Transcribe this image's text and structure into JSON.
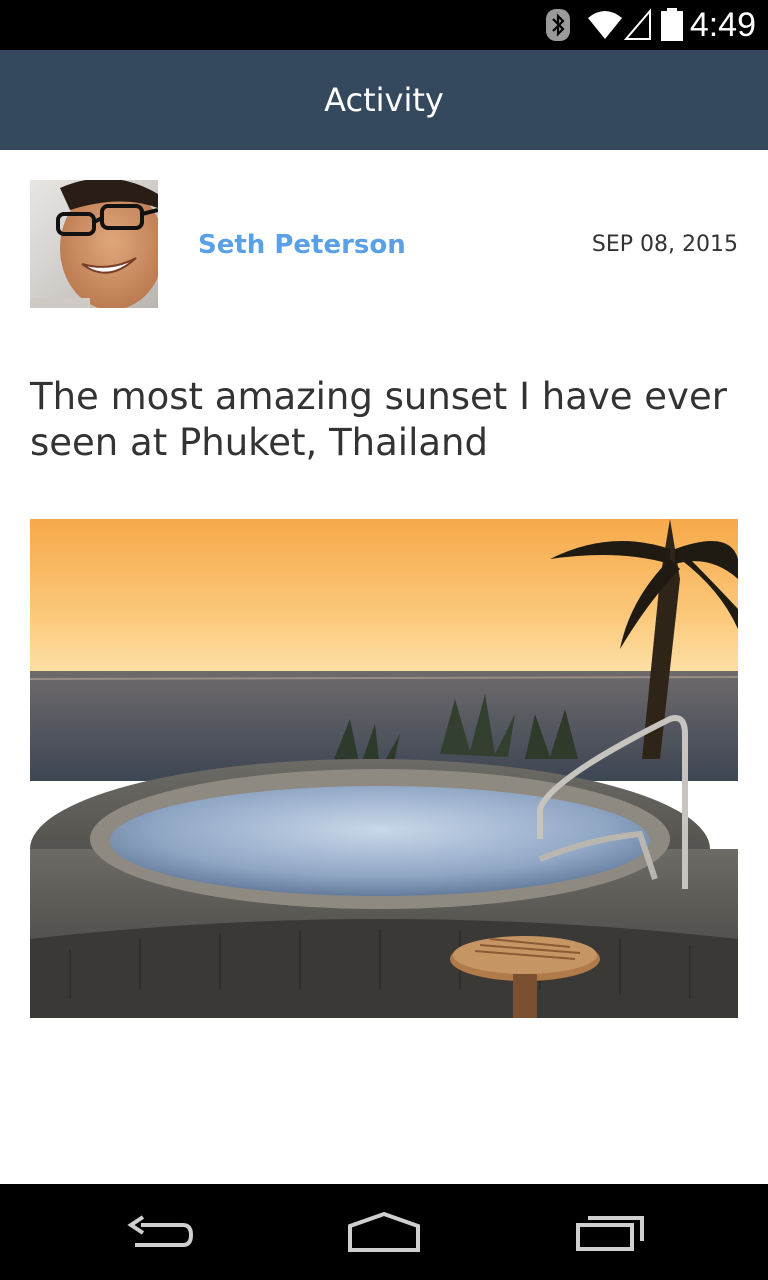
{
  "status_bar": {
    "time": "4:49",
    "icons": [
      "bluetooth-icon",
      "wifi-icon",
      "signal-icon",
      "battery-icon"
    ]
  },
  "action_bar": {
    "title": "Activity",
    "background_color": "#34495e"
  },
  "post": {
    "author": "Seth Peterson",
    "date": "SEP 08, 2015",
    "caption": "The most amazing sunset I have ever seen at Phuket, Thailand",
    "author_color": "#5aa0e6"
  },
  "nav_bar": {
    "buttons": [
      "back-icon",
      "home-icon",
      "recents-icon"
    ]
  }
}
